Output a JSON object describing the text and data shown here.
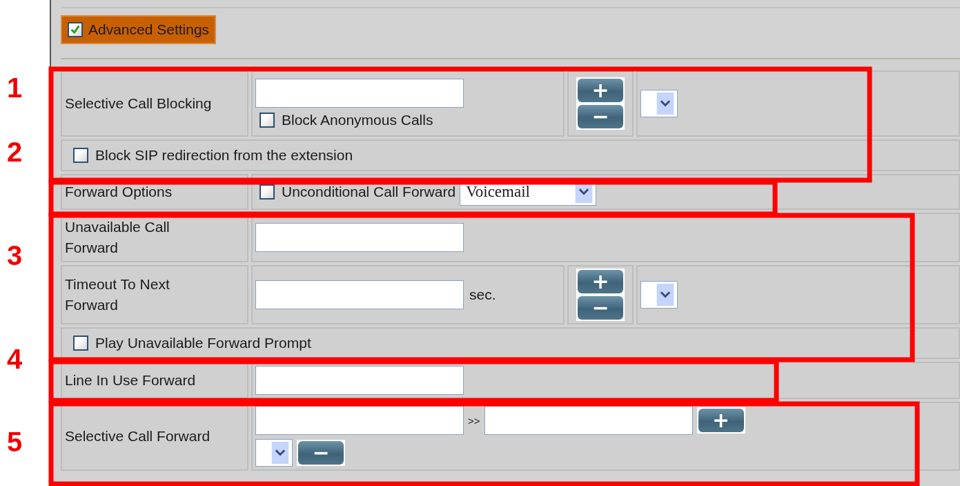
{
  "advanced_settings": {
    "label": "Advanced Settings",
    "checked": true
  },
  "rows": [
    {
      "kind": "blocking",
      "label": "Selective Call Blocking",
      "checkbox": {
        "label": "Block Anonymous Calls",
        "checked": false
      },
      "buttons": [
        "+",
        "−"
      ]
    },
    {
      "kind": "checkbox",
      "label": "Block SIP redirection from the extension",
      "checked": false
    },
    {
      "kind": "forward_options",
      "label": "Forward Options",
      "checkbox": {
        "label": "Unconditional Call Forward",
        "checked": false
      },
      "select": "Voicemail"
    },
    {
      "kind": "input",
      "label": "Unavailable Call Forward"
    },
    {
      "kind": "timeout",
      "label": "Timeout To Next Forward",
      "unit": "sec.",
      "buttons": [
        "+",
        "−"
      ]
    },
    {
      "kind": "checkbox",
      "label": "Play Unavailable Forward Prompt",
      "checked": false
    },
    {
      "kind": "input",
      "label": "Line In Use Forward"
    },
    {
      "kind": "selective_forward",
      "label": "Selective Call Forward",
      "separator": ">>",
      "buttons": [
        "+",
        "−"
      ]
    }
  ],
  "callouts": [
    "1",
    "2",
    "3",
    "4",
    "5"
  ]
}
